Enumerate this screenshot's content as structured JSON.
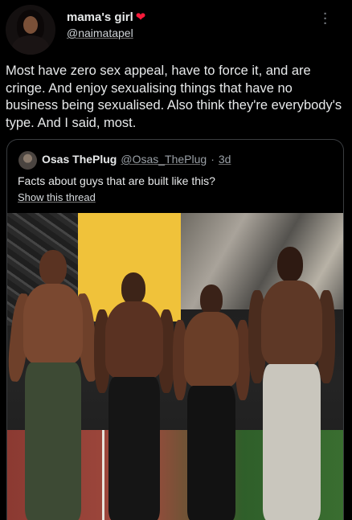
{
  "tweet": {
    "display_name": "mama's girl",
    "name_emoji": "❤",
    "handle": "@naimatapel",
    "more_icon": "more-dots-icon",
    "text": "Most have zero sex appeal, have to force it, and are cringe. And enjoy sexualising things that have no business being sexualised. Also think they're everybody's type. And I said, most."
  },
  "quoted_tweet": {
    "display_name": "Osas ThePlug",
    "handle": "@Osas_ThePlug",
    "separator": "·",
    "time": "3d",
    "text": "Facts about guys that are built like this?",
    "show_thread_label": "Show this thread"
  },
  "colors": {
    "background": "#000000",
    "text": "#e7e9ea",
    "muted": "#71767b",
    "heart": "#f91a3a",
    "border": "#3a3d40"
  }
}
